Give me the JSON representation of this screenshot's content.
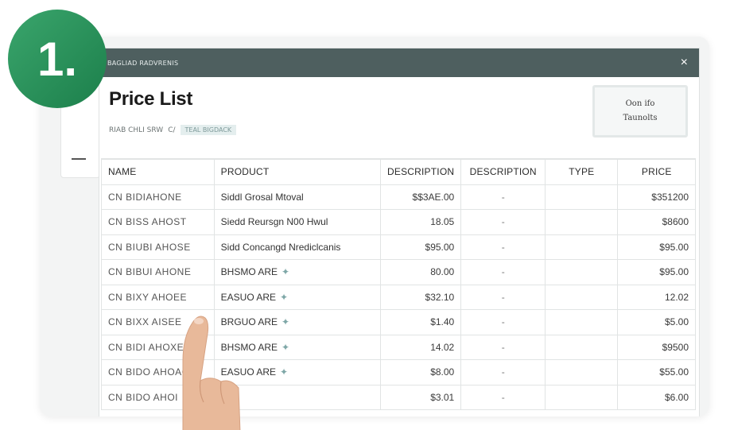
{
  "step_badge": "1.",
  "window": {
    "title": "BAGLIAD RADVRENIS",
    "close_label": "×"
  },
  "header": {
    "page_title": "Price List",
    "subline_text": "RIAB CHLI SRW",
    "subline_sep": "C/",
    "subline_tag": "TEAL BIGDACK",
    "action_button": {
      "line1": "Oon ifo",
      "line2": "Taunolts"
    }
  },
  "table": {
    "columns": [
      "NAME",
      "PRODUCT",
      "DESCRIPTION",
      "DESCRIPTION",
      "TYPE",
      "PRICE"
    ],
    "rows": [
      {
        "name": "CN BIDIAHONE",
        "product": "Siddl Grosal Mtoval",
        "desc": "$$3AE.00",
        "desc2": "-",
        "type": "",
        "price": "$351200",
        "icon": false
      },
      {
        "name": "CN BISS AHOST",
        "product": "Siedd Reursgn N00 Hwul",
        "desc": "18.05",
        "desc2": "-",
        "type": "",
        "price": "$8600",
        "icon": false
      },
      {
        "name": "CN BIUBI AHOSE",
        "product": "Sidd Concangd Nrediclcanis",
        "desc": "$95.00",
        "desc2": "-",
        "type": "",
        "price": "$95.00",
        "icon": false
      },
      {
        "name": "CN BIBUI AHONE",
        "product": "BHSMO ARE",
        "desc": "80.00",
        "desc2": "-",
        "type": "",
        "price": "$95.00",
        "icon": true
      },
      {
        "name": "CN BIXY AHOEE",
        "product": "EASUO ARE",
        "desc": "$32.10",
        "desc2": "-",
        "type": "",
        "price": "12.02",
        "icon": true
      },
      {
        "name": "CN BIXX AISEE",
        "product": "BRGUO ARE",
        "desc": "$1.40",
        "desc2": "-",
        "type": "",
        "price": "$5.00",
        "icon": true
      },
      {
        "name": "CN BIDI AHOXE",
        "product": "BHSMO ARE",
        "desc": "14.02",
        "desc2": "-",
        "type": "",
        "price": "$9500",
        "icon": true
      },
      {
        "name": "CN BIDO AHOAC",
        "product": "EASUO ARE",
        "desc": "$8.00",
        "desc2": "-",
        "type": "",
        "price": "$55.00",
        "icon": true
      },
      {
        "name": "CN BIDO AHOI",
        "product": "K",
        "desc": "$3.01",
        "desc2": "-",
        "type": "",
        "price": "$6.00",
        "icon": false
      }
    ]
  },
  "colors": {
    "titlebar": "#4e5f5f",
    "badge": "#2a9459",
    "accent_icon": "#7ea7a7"
  }
}
